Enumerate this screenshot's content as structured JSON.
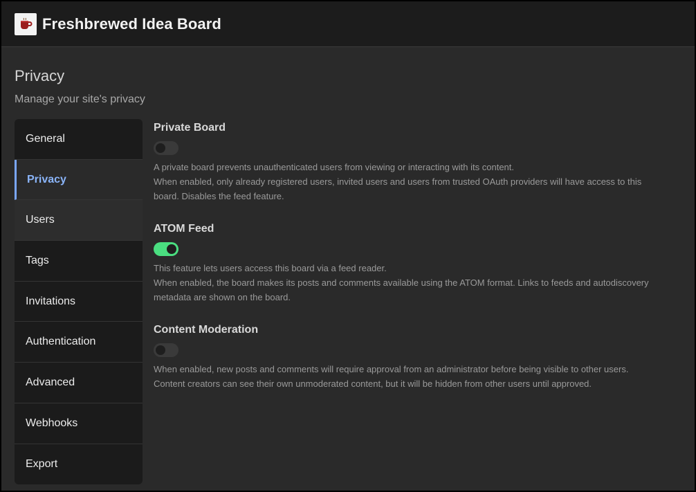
{
  "header": {
    "app_title": "Freshbrewed Idea Board",
    "logo_icon": "coffee-mug-icon"
  },
  "page": {
    "title": "Privacy",
    "subtitle": "Manage your site's privacy"
  },
  "sidebar": {
    "items": [
      {
        "label": "General",
        "active": false
      },
      {
        "label": "Privacy",
        "active": true
      },
      {
        "label": "Users",
        "active": false
      },
      {
        "label": "Tags",
        "active": false
      },
      {
        "label": "Invitations",
        "active": false
      },
      {
        "label": "Authentication",
        "active": false
      },
      {
        "label": "Advanced",
        "active": false
      },
      {
        "label": "Webhooks",
        "active": false
      },
      {
        "label": "Export",
        "active": false
      }
    ]
  },
  "settings": {
    "private_board": {
      "title": "Private Board",
      "enabled": false,
      "desc1": "A private board prevents unauthenticated users from viewing or interacting with its content.",
      "desc2": "When enabled, only already registered users, invited users and users from trusted OAuth providers will have access to this board. Disables the feed feature."
    },
    "atom_feed": {
      "title": "ATOM Feed",
      "enabled": true,
      "desc1": "This feature lets users access this board via a feed reader.",
      "desc2": "When enabled, the board makes its posts and comments available using the ATOM format. Links to feeds and autodiscovery metadata are shown on the board."
    },
    "content_moderation": {
      "title": "Content Moderation",
      "enabled": false,
      "desc1": "When enabled, new posts and comments will require approval from an administrator before being visible to other users.",
      "desc2": "Content creators can see their own unmoderated content, but it will be hidden from other users until approved."
    }
  },
  "colors": {
    "accent": "#8ab4f8",
    "toggle_on": "#4ade80",
    "background": "#2a2a2a",
    "header_bg": "#1c1c1c"
  }
}
